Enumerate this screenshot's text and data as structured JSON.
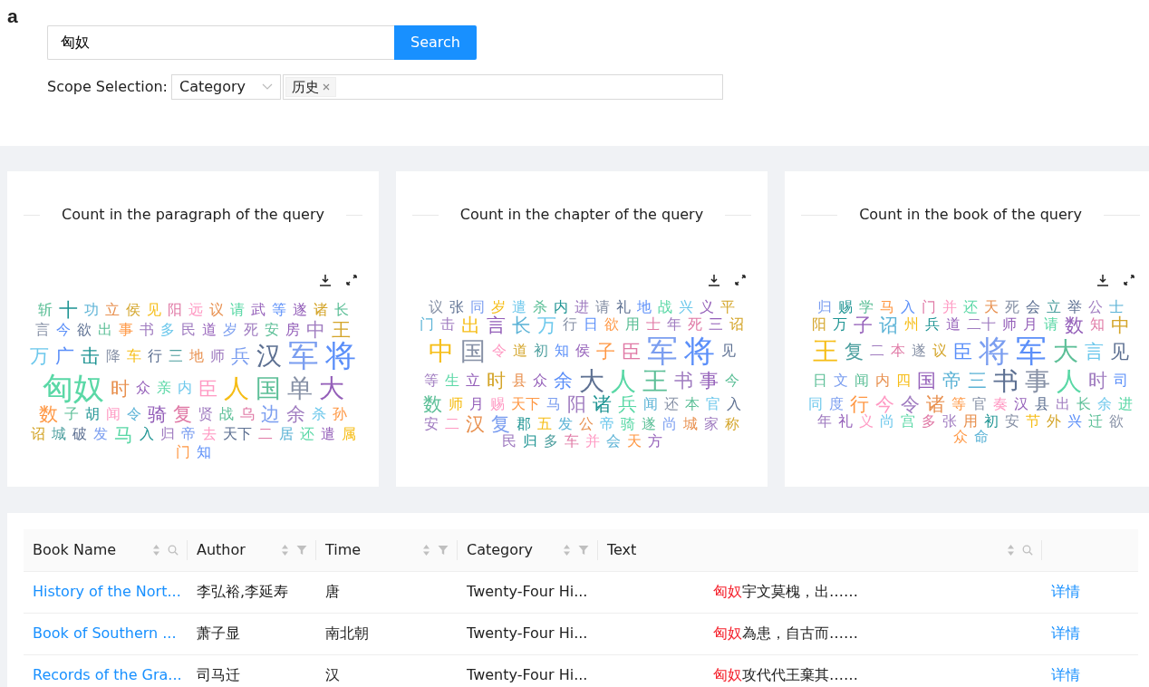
{
  "figure_label": "a",
  "search": {
    "value": "匈奴",
    "button": "Search"
  },
  "scope": {
    "label": "Scope Selection:",
    "select": "Category",
    "tags": [
      "历史"
    ]
  },
  "clouds": [
    {
      "title": "Count in the paragraph of the query",
      "words": [
        {
          "text": "斩",
          "color": "#5cbf97",
          "kind": "small"
        },
        {
          "text": "十",
          "color": "#1e9493",
          "kind": "medium"
        },
        {
          "text": "功",
          "color": "#5cb3d6",
          "kind": "small"
        },
        {
          "text": "立",
          "color": "#e8904f",
          "kind": "small"
        },
        {
          "text": "侯",
          "color": "#d4a52a",
          "kind": "small"
        },
        {
          "text": "见",
          "color": "#f6bd16",
          "kind": "small"
        },
        {
          "text": "阳",
          "color": "#e07aa6",
          "kind": "small"
        },
        {
          "text": "远",
          "color": "#ff99c3",
          "kind": "small"
        },
        {
          "text": "议",
          "color": "#e8904f",
          "kind": "small"
        },
        {
          "text": "请",
          "color": "#5ad8a6",
          "kind": "small"
        },
        {
          "text": "武",
          "color": "#945fb9",
          "kind": "small"
        },
        {
          "text": "等",
          "color": "#5b8ff9",
          "kind": "small"
        },
        {
          "text": "遂",
          "color": "#945fb9",
          "kind": "small"
        },
        {
          "text": "诸",
          "color": "#d4a52a",
          "kind": "small"
        },
        {
          "text": "长",
          "color": "#5cbf97",
          "kind": "small"
        },
        {
          "text": "言",
          "color": "#8791a6",
          "kind": "small"
        },
        {
          "text": "今",
          "color": "#5b8ff9",
          "kind": "small"
        },
        {
          "text": "欲",
          "color": "#5d7092",
          "kind": "small"
        },
        {
          "text": "出",
          "color": "#5cbf97",
          "kind": "small"
        },
        {
          "text": "事",
          "color": "#ff9845",
          "kind": "small"
        },
        {
          "text": "书",
          "color": "#a07cc0",
          "kind": "small"
        },
        {
          "text": "多",
          "color": "#6dc8ec",
          "kind": "small"
        },
        {
          "text": "民",
          "color": "#a07cc0",
          "kind": "small"
        },
        {
          "text": "道",
          "color": "#945fb9",
          "kind": "small"
        },
        {
          "text": "岁",
          "color": "#7b9ef0",
          "kind": "small"
        },
        {
          "text": "死",
          "color": "#a07cc0",
          "kind": "small"
        },
        {
          "text": "安",
          "color": "#5cbf97",
          "kind": "small"
        },
        {
          "text": "房",
          "color": "#945fb9",
          "kind": "small"
        },
        {
          "text": "中",
          "color": "#a07cc0",
          "kind": "medium"
        },
        {
          "text": "王",
          "color": "#d4a52a",
          "kind": "medium"
        },
        {
          "text": "万",
          "color": "#6dc8ec",
          "kind": "medium"
        },
        {
          "text": "广",
          "color": "#5b8ff9",
          "kind": "medium"
        },
        {
          "text": "击",
          "color": "#1e9493",
          "kind": "medium"
        },
        {
          "text": "降",
          "color": "#8791a6",
          "kind": "small"
        },
        {
          "text": "车",
          "color": "#f6bd16",
          "kind": "small"
        },
        {
          "text": "行",
          "color": "#5d7092",
          "kind": "small"
        },
        {
          "text": "三",
          "color": "#4fa0a0",
          "kind": "small"
        },
        {
          "text": "地",
          "color": "#e8904f",
          "kind": "small"
        },
        {
          "text": "师",
          "color": "#a07cc0",
          "kind": "small"
        },
        {
          "text": "兵",
          "color": "#7b9ef0",
          "kind": "medium"
        },
        {
          "text": "汉",
          "color": "#5d7092",
          "kind": "large"
        },
        {
          "text": "军",
          "color": "#7b9ef0",
          "kind": "huge"
        },
        {
          "text": "将",
          "color": "#5b8ff9",
          "kind": "huge"
        },
        {
          "text": "匈奴",
          "color": "#5ad8a6",
          "kind": "huge"
        },
        {
          "text": "时",
          "color": "#e8904f",
          "kind": "medium"
        },
        {
          "text": "众",
          "color": "#945fb9",
          "kind": "small"
        },
        {
          "text": "亲",
          "color": "#5ad8a6",
          "kind": "small"
        },
        {
          "text": "内",
          "color": "#6dc8ec",
          "kind": "small"
        },
        {
          "text": "臣",
          "color": "#ff99c3",
          "kind": "medium"
        },
        {
          "text": "人",
          "color": "#f6bd16",
          "kind": "large"
        },
        {
          "text": "国",
          "color": "#5cbf97",
          "kind": "large"
        },
        {
          "text": "单",
          "color": "#8791a6",
          "kind": "large"
        },
        {
          "text": "大",
          "color": "#945fb9",
          "kind": "large"
        },
        {
          "text": "数",
          "color": "#ff9845",
          "kind": "medium"
        },
        {
          "text": "子",
          "color": "#5cbf97",
          "kind": "small"
        },
        {
          "text": "胡",
          "color": "#1e9493",
          "kind": "small"
        },
        {
          "text": "闻",
          "color": "#ff99c3",
          "kind": "small"
        },
        {
          "text": "令",
          "color": "#5cb3d6",
          "kind": "small"
        },
        {
          "text": "骑",
          "color": "#945fb9",
          "kind": "medium"
        },
        {
          "text": "复",
          "color": "#e07aa6",
          "kind": "medium"
        },
        {
          "text": "贤",
          "color": "#a07cc0",
          "kind": "small"
        },
        {
          "text": "战",
          "color": "#5cbf97",
          "kind": "small"
        },
        {
          "text": "乌",
          "color": "#e07aa6",
          "kind": "small"
        },
        {
          "text": "边",
          "color": "#7b9ef0",
          "kind": "medium"
        },
        {
          "text": "余",
          "color": "#a07cc0",
          "kind": "medium"
        },
        {
          "text": "杀",
          "color": "#6dc8ec",
          "kind": "small"
        },
        {
          "text": "孙",
          "color": "#ff9845",
          "kind": "small"
        },
        {
          "text": "诏",
          "color": "#d4a52a",
          "kind": "small"
        },
        {
          "text": "城",
          "color": "#4fa0a0",
          "kind": "small"
        },
        {
          "text": "破",
          "color": "#5d7092",
          "kind": "small"
        },
        {
          "text": "发",
          "color": "#7b9ef0",
          "kind": "small"
        },
        {
          "text": "马",
          "color": "#5ad8a6",
          "kind": "medium"
        },
        {
          "text": "入",
          "color": "#1e9493",
          "kind": "small"
        },
        {
          "text": "归",
          "color": "#a07cc0",
          "kind": "small"
        },
        {
          "text": "帝",
          "color": "#7b9ef0",
          "kind": "small"
        },
        {
          "text": "去",
          "color": "#ff99c3",
          "kind": "small"
        },
        {
          "text": "天下",
          "color": "#5d7092",
          "kind": "small"
        },
        {
          "text": "二",
          "color": "#e07aa6",
          "kind": "small"
        },
        {
          "text": "居",
          "color": "#5cb3d6",
          "kind": "small"
        },
        {
          "text": "还",
          "color": "#5ad8a6",
          "kind": "small"
        },
        {
          "text": "遣",
          "color": "#945fb9",
          "kind": "small"
        },
        {
          "text": "属",
          "color": "#f6bd16",
          "kind": "small"
        },
        {
          "text": "门",
          "color": "#ff9845",
          "kind": "small"
        },
        {
          "text": "知",
          "color": "#5b8ff9",
          "kind": "small"
        }
      ]
    },
    {
      "title": "Count in the chapter of the query",
      "words": [
        {
          "text": "议",
          "color": "#8791a6",
          "kind": "small"
        },
        {
          "text": "张",
          "color": "#5d7092",
          "kind": "small"
        },
        {
          "text": "同",
          "color": "#7b9ef0",
          "kind": "small"
        },
        {
          "text": "岁",
          "color": "#f6bd16",
          "kind": "small"
        },
        {
          "text": "遣",
          "color": "#6dc8ec",
          "kind": "small"
        },
        {
          "text": "杀",
          "color": "#5cbf97",
          "kind": "small"
        },
        {
          "text": "内",
          "color": "#1e9493",
          "kind": "small"
        },
        {
          "text": "进",
          "color": "#a07cc0",
          "kind": "small"
        },
        {
          "text": "请",
          "color": "#8791a6",
          "kind": "small"
        },
        {
          "text": "礼",
          "color": "#5d7092",
          "kind": "small"
        },
        {
          "text": "地",
          "color": "#5b8ff9",
          "kind": "small"
        },
        {
          "text": "战",
          "color": "#5ad8a6",
          "kind": "small"
        },
        {
          "text": "兴",
          "color": "#6dc8ec",
          "kind": "small"
        },
        {
          "text": "义",
          "color": "#945fb9",
          "kind": "small"
        },
        {
          "text": "平",
          "color": "#d4a52a",
          "kind": "small"
        },
        {
          "text": "门",
          "color": "#5cb3d6",
          "kind": "small"
        },
        {
          "text": "击",
          "color": "#a07cc0",
          "kind": "small"
        },
        {
          "text": "出",
          "color": "#f6bd16",
          "kind": "medium"
        },
        {
          "text": "言",
          "color": "#945fb9",
          "kind": "medium"
        },
        {
          "text": "长",
          "color": "#5cb3d6",
          "kind": "medium"
        },
        {
          "text": "万",
          "color": "#6dc8ec",
          "kind": "medium"
        },
        {
          "text": "行",
          "color": "#8791a6",
          "kind": "small"
        },
        {
          "text": "日",
          "color": "#5b8ff9",
          "kind": "small"
        },
        {
          "text": "欲",
          "color": "#ff9845",
          "kind": "small"
        },
        {
          "text": "用",
          "color": "#5cbf97",
          "kind": "small"
        },
        {
          "text": "士",
          "color": "#e07aa6",
          "kind": "small"
        },
        {
          "text": "年",
          "color": "#a07cc0",
          "kind": "small"
        },
        {
          "text": "死",
          "color": "#e07aa6",
          "kind": "small"
        },
        {
          "text": "三",
          "color": "#945fb9",
          "kind": "small"
        },
        {
          "text": "诏",
          "color": "#d4a52a",
          "kind": "small"
        },
        {
          "text": "中",
          "color": "#f6bd16",
          "kind": "large"
        },
        {
          "text": "国",
          "color": "#8791a6",
          "kind": "large"
        },
        {
          "text": "令",
          "color": "#ff99c3",
          "kind": "small"
        },
        {
          "text": "道",
          "color": "#d4a52a",
          "kind": "small"
        },
        {
          "text": "初",
          "color": "#4fa0a0",
          "kind": "small"
        },
        {
          "text": "知",
          "color": "#5b8ff9",
          "kind": "small"
        },
        {
          "text": "侯",
          "color": "#945fb9",
          "kind": "small"
        },
        {
          "text": "子",
          "color": "#ff9845",
          "kind": "medium"
        },
        {
          "text": "臣",
          "color": "#e07aa6",
          "kind": "medium"
        },
        {
          "text": "军",
          "color": "#7b9ef0",
          "kind": "huge"
        },
        {
          "text": "将",
          "color": "#5b8ff9",
          "kind": "huge"
        },
        {
          "text": "见",
          "color": "#5d7092",
          "kind": "small"
        },
        {
          "text": "等",
          "color": "#a07cc0",
          "kind": "small"
        },
        {
          "text": "生",
          "color": "#5ad8a6",
          "kind": "small"
        },
        {
          "text": "立",
          "color": "#945fb9",
          "kind": "small"
        },
        {
          "text": "时",
          "color": "#d4a52a",
          "kind": "medium"
        },
        {
          "text": "县",
          "color": "#e8904f",
          "kind": "small"
        },
        {
          "text": "众",
          "color": "#945fb9",
          "kind": "small"
        },
        {
          "text": "余",
          "color": "#5b8ff9",
          "kind": "medium"
        },
        {
          "text": "大",
          "color": "#5d7092",
          "kind": "large"
        },
        {
          "text": "人",
          "color": "#5ad8a6",
          "kind": "large"
        },
        {
          "text": "王",
          "color": "#5cbf97",
          "kind": "large"
        },
        {
          "text": "书",
          "color": "#a07cc0",
          "kind": "medium"
        },
        {
          "text": "事",
          "color": "#945fb9",
          "kind": "medium"
        },
        {
          "text": "今",
          "color": "#5cbf97",
          "kind": "small"
        },
        {
          "text": "数",
          "color": "#5cbf97",
          "kind": "medium"
        },
        {
          "text": "师",
          "color": "#f6bd16",
          "kind": "small"
        },
        {
          "text": "月",
          "color": "#945fb9",
          "kind": "small"
        },
        {
          "text": "赐",
          "color": "#ff99c3",
          "kind": "small"
        },
        {
          "text": "天下",
          "color": "#ff9845",
          "kind": "small"
        },
        {
          "text": "马",
          "color": "#7b9ef0",
          "kind": "small"
        },
        {
          "text": "阳",
          "color": "#a07cc0",
          "kind": "medium"
        },
        {
          "text": "诸",
          "color": "#1e9493",
          "kind": "medium"
        },
        {
          "text": "兵",
          "color": "#5ad8a6",
          "kind": "medium"
        },
        {
          "text": "闻",
          "color": "#5cb3d6",
          "kind": "small"
        },
        {
          "text": "还",
          "color": "#8791a6",
          "kind": "small"
        },
        {
          "text": "本",
          "color": "#5cbf97",
          "kind": "small"
        },
        {
          "text": "官",
          "color": "#6dc8ec",
          "kind": "small"
        },
        {
          "text": "入",
          "color": "#5d7092",
          "kind": "small"
        },
        {
          "text": "安",
          "color": "#a07cc0",
          "kind": "small"
        },
        {
          "text": "二",
          "color": "#ff99c3",
          "kind": "small"
        },
        {
          "text": "汉",
          "color": "#e8904f",
          "kind": "medium"
        },
        {
          "text": "复",
          "color": "#7b9ef0",
          "kind": "medium"
        },
        {
          "text": "郡",
          "color": "#1e9493",
          "kind": "small"
        },
        {
          "text": "五",
          "color": "#f6bd16",
          "kind": "small"
        },
        {
          "text": "发",
          "color": "#5cb3d6",
          "kind": "small"
        },
        {
          "text": "公",
          "color": "#e8904f",
          "kind": "small"
        },
        {
          "text": "帝",
          "color": "#6dc8ec",
          "kind": "small"
        },
        {
          "text": "骑",
          "color": "#5ad8a6",
          "kind": "small"
        },
        {
          "text": "遂",
          "color": "#5cbf97",
          "kind": "small"
        },
        {
          "text": "尚",
          "color": "#7b9ef0",
          "kind": "small"
        },
        {
          "text": "城",
          "color": "#e8904f",
          "kind": "small"
        },
        {
          "text": "家",
          "color": "#a07cc0",
          "kind": "small"
        },
        {
          "text": "称",
          "color": "#d4a52a",
          "kind": "small"
        },
        {
          "text": "民",
          "color": "#a07cc0",
          "kind": "small"
        },
        {
          "text": "归",
          "color": "#1e9493",
          "kind": "small"
        },
        {
          "text": "多",
          "color": "#4fa0a0",
          "kind": "small"
        },
        {
          "text": "车",
          "color": "#e07aa6",
          "kind": "small"
        },
        {
          "text": "并",
          "color": "#ff99c3",
          "kind": "small"
        },
        {
          "text": "会",
          "color": "#5cb3d6",
          "kind": "small"
        },
        {
          "text": "天",
          "color": "#ff9845",
          "kind": "small"
        },
        {
          "text": "方",
          "color": "#945fb9",
          "kind": "small"
        }
      ]
    },
    {
      "title": "Count in the book of the query",
      "words": [
        {
          "text": "归",
          "color": "#7b9ef0",
          "kind": "small"
        },
        {
          "text": "赐",
          "color": "#1e9493",
          "kind": "small"
        },
        {
          "text": "学",
          "color": "#5cbf97",
          "kind": "small"
        },
        {
          "text": "马",
          "color": "#ff9845",
          "kind": "small"
        },
        {
          "text": "入",
          "color": "#5b8ff9",
          "kind": "small"
        },
        {
          "text": "门",
          "color": "#e07aa6",
          "kind": "small"
        },
        {
          "text": "并",
          "color": "#ff99c3",
          "kind": "small"
        },
        {
          "text": "还",
          "color": "#5ad8a6",
          "kind": "small"
        },
        {
          "text": "天",
          "color": "#e8904f",
          "kind": "small"
        },
        {
          "text": "死",
          "color": "#8791a6",
          "kind": "small"
        },
        {
          "text": "会",
          "color": "#5d7092",
          "kind": "small"
        },
        {
          "text": "立",
          "color": "#4fa0a0",
          "kind": "small"
        },
        {
          "text": "举",
          "color": "#5d7092",
          "kind": "small"
        },
        {
          "text": "公",
          "color": "#a07cc0",
          "kind": "small"
        },
        {
          "text": "士",
          "color": "#5cb3d6",
          "kind": "small"
        },
        {
          "text": "阳",
          "color": "#d4a52a",
          "kind": "small"
        },
        {
          "text": "万",
          "color": "#1e9493",
          "kind": "small"
        },
        {
          "text": "子",
          "color": "#945fb9",
          "kind": "medium"
        },
        {
          "text": "诏",
          "color": "#5cb3d6",
          "kind": "medium"
        },
        {
          "text": "州",
          "color": "#f6bd16",
          "kind": "small"
        },
        {
          "text": "兵",
          "color": "#1e9493",
          "kind": "small"
        },
        {
          "text": "道",
          "color": "#945fb9",
          "kind": "small"
        },
        {
          "text": "二十",
          "color": "#a07cc0",
          "kind": "small"
        },
        {
          "text": "师",
          "color": "#945fb9",
          "kind": "small"
        },
        {
          "text": "月",
          "color": "#945fb9",
          "kind": "small"
        },
        {
          "text": "请",
          "color": "#5ad8a6",
          "kind": "small"
        },
        {
          "text": "数",
          "color": "#945fb9",
          "kind": "medium"
        },
        {
          "text": "知",
          "color": "#e07aa6",
          "kind": "small"
        },
        {
          "text": "中",
          "color": "#d4a52a",
          "kind": "medium"
        },
        {
          "text": "王",
          "color": "#f6bd16",
          "kind": "large"
        },
        {
          "text": "复",
          "color": "#4fa0a0",
          "kind": "medium"
        },
        {
          "text": "二",
          "color": "#a07cc0",
          "kind": "small"
        },
        {
          "text": "本",
          "color": "#e07aa6",
          "kind": "small"
        },
        {
          "text": "遂",
          "color": "#8791a6",
          "kind": "small"
        },
        {
          "text": "议",
          "color": "#d4a52a",
          "kind": "small"
        },
        {
          "text": "臣",
          "color": "#5b8ff9",
          "kind": "medium"
        },
        {
          "text": "将",
          "color": "#7b9ef0",
          "kind": "huge"
        },
        {
          "text": "军",
          "color": "#5b8ff9",
          "kind": "huge"
        },
        {
          "text": "大",
          "color": "#5cbf97",
          "kind": "large"
        },
        {
          "text": "言",
          "color": "#6dc8ec",
          "kind": "medium"
        },
        {
          "text": "见",
          "color": "#5d7092",
          "kind": "medium"
        },
        {
          "text": "日",
          "color": "#5cbf97",
          "kind": "small"
        },
        {
          "text": "文",
          "color": "#7b9ef0",
          "kind": "small"
        },
        {
          "text": "闻",
          "color": "#5cbf97",
          "kind": "small"
        },
        {
          "text": "内",
          "color": "#e8904f",
          "kind": "small"
        },
        {
          "text": "四",
          "color": "#f6bd16",
          "kind": "small"
        },
        {
          "text": "国",
          "color": "#945fb9",
          "kind": "medium"
        },
        {
          "text": "帝",
          "color": "#5cb3d6",
          "kind": "medium"
        },
        {
          "text": "三",
          "color": "#5cb3d6",
          "kind": "medium"
        },
        {
          "text": "书",
          "color": "#5d7092",
          "kind": "large"
        },
        {
          "text": "事",
          "color": "#8791a6",
          "kind": "large"
        },
        {
          "text": "人",
          "color": "#5ad8a6",
          "kind": "large"
        },
        {
          "text": "时",
          "color": "#a07cc0",
          "kind": "medium"
        },
        {
          "text": "司",
          "color": "#5b8ff9",
          "kind": "small"
        },
        {
          "text": "同",
          "color": "#6dc8ec",
          "kind": "small"
        },
        {
          "text": "度",
          "color": "#7b9ef0",
          "kind": "small"
        },
        {
          "text": "行",
          "color": "#ff9845",
          "kind": "medium"
        },
        {
          "text": "今",
          "color": "#ff99c3",
          "kind": "medium"
        },
        {
          "text": "令",
          "color": "#a07cc0",
          "kind": "medium"
        },
        {
          "text": "诸",
          "color": "#e8904f",
          "kind": "medium"
        },
        {
          "text": "等",
          "color": "#ff9845",
          "kind": "small"
        },
        {
          "text": "官",
          "color": "#8791a6",
          "kind": "small"
        },
        {
          "text": "奏",
          "color": "#ff99c3",
          "kind": "small"
        },
        {
          "text": "汉",
          "color": "#945fb9",
          "kind": "small"
        },
        {
          "text": "县",
          "color": "#5d7092",
          "kind": "small"
        },
        {
          "text": "出",
          "color": "#a07cc0",
          "kind": "small"
        },
        {
          "text": "长",
          "color": "#5cbf97",
          "kind": "small"
        },
        {
          "text": "余",
          "color": "#6dc8ec",
          "kind": "small"
        },
        {
          "text": "进",
          "color": "#5ad8a6",
          "kind": "small"
        },
        {
          "text": "年",
          "color": "#a07cc0",
          "kind": "small"
        },
        {
          "text": "礼",
          "color": "#945fb9",
          "kind": "small"
        },
        {
          "text": "义",
          "color": "#ff99c3",
          "kind": "small"
        },
        {
          "text": "尚",
          "color": "#6dc8ec",
          "kind": "small"
        },
        {
          "text": "宫",
          "color": "#5ad8a6",
          "kind": "small"
        },
        {
          "text": "多",
          "color": "#e07aa6",
          "kind": "small"
        },
        {
          "text": "张",
          "color": "#a07cc0",
          "kind": "small"
        },
        {
          "text": "用",
          "color": "#e8904f",
          "kind": "small"
        },
        {
          "text": "初",
          "color": "#1e9493",
          "kind": "small"
        },
        {
          "text": "安",
          "color": "#8791a6",
          "kind": "small"
        },
        {
          "text": "节",
          "color": "#f6bd16",
          "kind": "small"
        },
        {
          "text": "外",
          "color": "#d4a52a",
          "kind": "small"
        },
        {
          "text": "兴",
          "color": "#5b8ff9",
          "kind": "small"
        },
        {
          "text": "迁",
          "color": "#5cbf97",
          "kind": "small"
        },
        {
          "text": "欲",
          "color": "#8791a6",
          "kind": "small"
        },
        {
          "text": "众",
          "color": "#ff9845",
          "kind": "small"
        },
        {
          "text": "命",
          "color": "#5cb3d6",
          "kind": "small"
        }
      ]
    }
  ],
  "table": {
    "columns": [
      {
        "label": "Book Name",
        "kind": "search"
      },
      {
        "label": "Author",
        "kind": "funnel"
      },
      {
        "label": "Time",
        "kind": "funnel"
      },
      {
        "label": "Category",
        "kind": "funnel"
      },
      {
        "label": "Text",
        "kind": "search"
      }
    ],
    "rows": [
      {
        "book": "History of the Nort...",
        "author": "李弘裕,李延寿",
        "time": "唐",
        "category": "Twenty-Four Hi...",
        "highlight": "匈奴",
        "text": "宇文莫槐，出……",
        "action": "详情"
      },
      {
        "book": "Book of Southern ...",
        "author": "萧子显",
        "time": "南北朝",
        "category": "Twenty-Four Hi...",
        "highlight": "匈奴",
        "text": "為患，自古而……",
        "action": "详情"
      },
      {
        "book": "Records of the Gra...",
        "author": "司马迁",
        "time": "汉",
        "category": "Twenty-Four Hi...",
        "highlight": "匈奴",
        "text": "攻代代王棄其……",
        "action": "详情"
      }
    ]
  }
}
